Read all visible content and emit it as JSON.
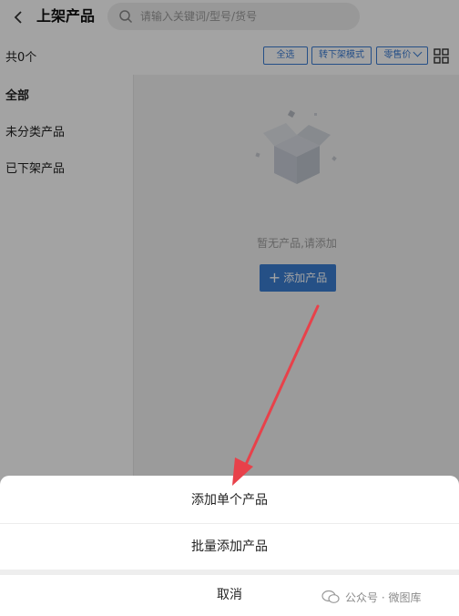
{
  "header": {
    "title": "上架产品",
    "search_placeholder": "请输入关键词/型号/货号"
  },
  "toolbar": {
    "count": "共0个",
    "select_all": "全选",
    "to_offshelf_mode": "转下架模式",
    "price_sort": "零售价"
  },
  "sidebar": {
    "items": [
      {
        "label": "全部"
      },
      {
        "label": "未分类产品"
      },
      {
        "label": "已下架产品"
      }
    ]
  },
  "empty": {
    "text": "暂无产品,请添加",
    "add_button": "添加产品"
  },
  "sheet": {
    "add_single": "添加单个产品",
    "batch_add": "批量添加产品",
    "cancel": "取消"
  },
  "watermark": {
    "text": "公众号 · 微图库"
  },
  "colors": {
    "accent": "#3b7cd4",
    "arrow": "#e8414a"
  }
}
